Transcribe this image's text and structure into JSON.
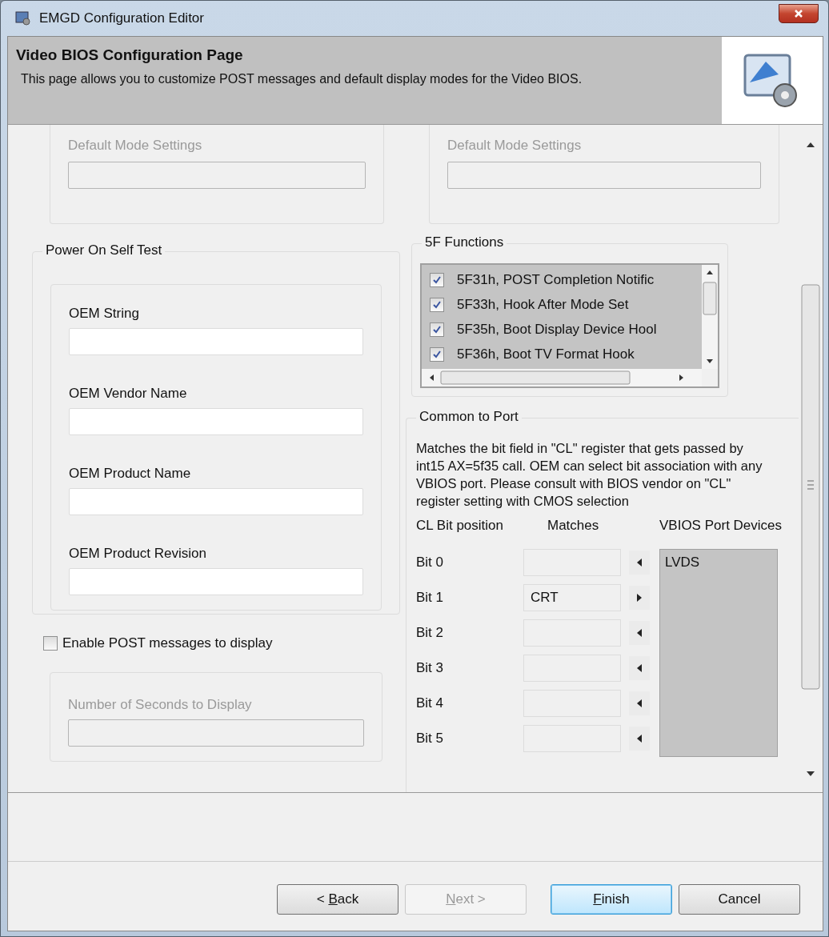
{
  "window": {
    "title": "EMGD Configuration Editor"
  },
  "header": {
    "title": "Video BIOS Configuration Page",
    "subtitle": "This page allows you to customize POST messages and default display modes for the Video BIOS."
  },
  "top_panels": [
    {
      "label": "Default Mode Settings",
      "disabled": true
    },
    {
      "label": "Default Mode Settings",
      "disabled": true
    }
  ],
  "post": {
    "title": "Power On Self Test",
    "fields": [
      {
        "label": "OEM String"
      },
      {
        "label": "OEM Vendor Name"
      },
      {
        "label": "OEM Product Name"
      },
      {
        "label": "OEM Product Revision"
      }
    ],
    "enable": {
      "label": "Enable POST messages to display",
      "checked": false
    },
    "seconds": {
      "label": "Number of Seconds to Display",
      "disabled": true
    }
  },
  "functions": {
    "title": "5F Functions",
    "items": [
      {
        "label": "5F31h, POST Completion Notific",
        "checked": true
      },
      {
        "label": "5F33h, Hook After Mode Set",
        "checked": true
      },
      {
        "label": "5F35h, Boot Display Device Hool",
        "checked": true
      },
      {
        "label": "5F36h, Boot TV Format Hook",
        "checked": true
      }
    ]
  },
  "common": {
    "title": "Common to Port",
    "description": "Matches the bit field in \"CL\" register that gets passed by int15 AX=5f35 call. OEM can select bit association with any VBIOS port. Please consult with BIOS vendor on \"CL\" register setting with CMOS selection",
    "columns": [
      "CL Bit position",
      "Matches",
      "VBIOS Port Devices"
    ],
    "bits": [
      {
        "label": "Bit 0",
        "kind": "left"
      },
      {
        "label": "Bit 1",
        "value": "CRT",
        "kind": "right"
      },
      {
        "label": "Bit 2",
        "kind": "left"
      },
      {
        "label": "Bit 3",
        "kind": "left"
      },
      {
        "label": "Bit 4",
        "kind": "left"
      },
      {
        "label": "Bit 5",
        "kind": "left"
      }
    ],
    "devices": [
      "LVDS"
    ]
  },
  "buttons": [
    {
      "before": "< ",
      "mnemonic": "B",
      "after": "ack",
      "disabled": false,
      "default": false
    },
    {
      "mnemonic": "N",
      "after": "ext >",
      "disabled": true,
      "default": false
    },
    {
      "mnemonic": "F",
      "after": "inish",
      "disabled": false,
      "default": true
    },
    {
      "before": "Cancel",
      "disabled": false,
      "default": false
    }
  ]
}
